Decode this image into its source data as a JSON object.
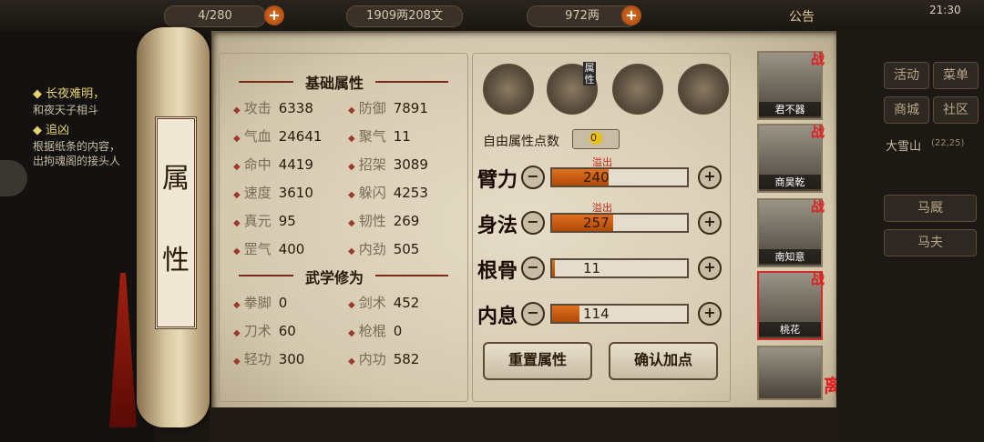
{
  "topbar": {
    "res1": "4/280",
    "res2": "1909两208文",
    "res3": "972两",
    "announce": "公告",
    "time": "21:30"
  },
  "left": {
    "q1": "长夜难明，",
    "q1sub": "和夜天子相斗",
    "q2": "追凶",
    "q2sub1": "根据纸条的内容，",
    "q2sub2": "出拘魂阁的接头人"
  },
  "scroll": {
    "title1": "属",
    "title2": "性"
  },
  "stats": {
    "header": "基础属性",
    "items": [
      {
        "label": "攻击",
        "value": "6338"
      },
      {
        "label": "防御",
        "value": "7891"
      },
      {
        "label": "气血",
        "value": "24641"
      },
      {
        "label": "聚气",
        "value": "11"
      },
      {
        "label": "命中",
        "value": "4419"
      },
      {
        "label": "招架",
        "value": "3089"
      },
      {
        "label": "速度",
        "value": "3610"
      },
      {
        "label": "躲闪",
        "value": "4253"
      },
      {
        "label": "真元",
        "value": "95"
      },
      {
        "label": "韧性",
        "value": "269"
      },
      {
        "label": "罡气",
        "value": "400"
      },
      {
        "label": "内劲",
        "value": "505"
      }
    ],
    "martial_header": "武学修为",
    "martial": [
      {
        "label": "拳脚",
        "value": "0"
      },
      {
        "label": "剑术",
        "value": "452"
      },
      {
        "label": "刀术",
        "value": "60"
      },
      {
        "label": "枪棍",
        "value": "0"
      },
      {
        "label": "轻功",
        "value": "300"
      },
      {
        "label": "内功",
        "value": "582"
      }
    ]
  },
  "attrs": {
    "tab_label": "属性",
    "free_points_label": "自由属性点数",
    "free_points": "0",
    "rows": [
      {
        "name": "臂力",
        "value": "240",
        "overflow": "溢出",
        "fill": 0.42
      },
      {
        "name": "身法",
        "value": "257",
        "overflow": "溢出",
        "fill": 0.45
      },
      {
        "name": "根骨",
        "value": "11",
        "overflow": "",
        "fill": 0.02
      },
      {
        "name": "内息",
        "value": "114",
        "overflow": "",
        "fill": 0.2
      }
    ],
    "reset": "重置属性",
    "confirm": "确认加点"
  },
  "heroes": {
    "h1": "君不器",
    "h2": "商昊乾",
    "h3": "南知意",
    "h4": "桃花",
    "zhan": "战",
    "leave": "离开"
  },
  "right": {
    "b1": "活动",
    "b2": "菜单",
    "b3": "商城",
    "b4": "社区",
    "loc": "大雪山",
    "coord": "(22,25)",
    "nav1": "马厩",
    "nav2": "马夫"
  }
}
